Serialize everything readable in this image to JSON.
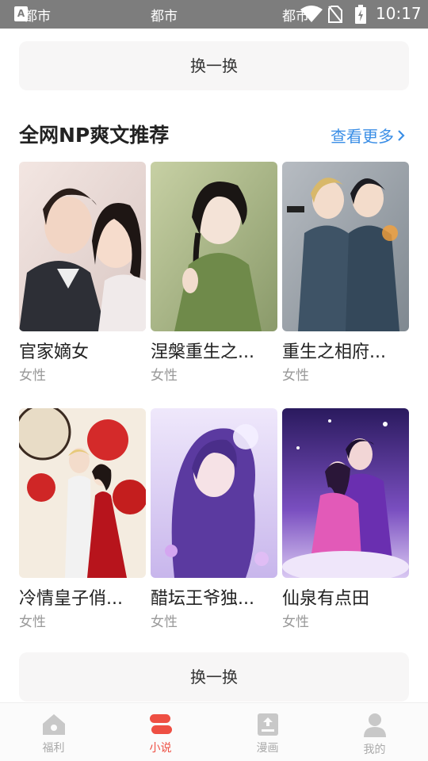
{
  "status_bar": {
    "left_label": "都市",
    "center_label": "都市",
    "carrier_label": "都市",
    "time": "10:17",
    "app_icon_letter": "A"
  },
  "swap_button_top": {
    "label": "换一换"
  },
  "section": {
    "title": "全网NP爽文推荐",
    "more_label": "查看更多",
    "accent_color": "#3a8ee6"
  },
  "books": [
    {
      "title": "官家嫡女",
      "tag": "女性"
    },
    {
      "title": "涅槃重生之...",
      "tag": "女性"
    },
    {
      "title": "重生之相府...",
      "tag": "女性"
    },
    {
      "title": "冷情皇子俏...",
      "tag": "女性"
    },
    {
      "title": "醋坛王爷独...",
      "tag": "女性"
    },
    {
      "title": "仙泉有点田",
      "tag": "女性"
    }
  ],
  "swap_button_bottom": {
    "label": "换一换"
  },
  "tabbar": {
    "active_color": "#ee4f43",
    "tabs": [
      {
        "label": "福利",
        "icon": "home-icon",
        "active": false
      },
      {
        "label": "小说",
        "icon": "novel-icon",
        "active": true
      },
      {
        "label": "漫画",
        "icon": "comic-icon",
        "active": false
      },
      {
        "label": "我的",
        "icon": "profile-icon",
        "active": false
      }
    ]
  }
}
